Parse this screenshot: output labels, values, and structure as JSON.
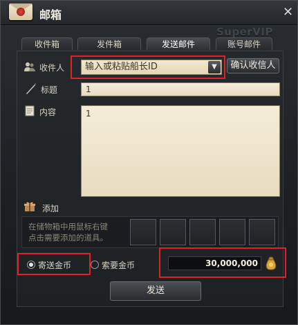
{
  "window": {
    "title": "邮箱",
    "watermark": "SuperVIP"
  },
  "tabs": [
    {
      "label": "收件箱"
    },
    {
      "label": "发件箱"
    },
    {
      "label": "发送邮件"
    },
    {
      "label": "账号邮件"
    }
  ],
  "form": {
    "recipient_label": "收件人",
    "recipient_placeholder": "输入或粘贴船长ID",
    "confirm_button": "确认收信人",
    "subject_label": "标题",
    "subject_value": "1",
    "content_label": "内容",
    "content_value": "1"
  },
  "attachment": {
    "label": "添加",
    "hint_line1": "在储物箱中用鼠标右键",
    "hint_line2": "点击需要添加的道具。",
    "slot_count": 5
  },
  "gold": {
    "send_label": "寄送金币",
    "request_label": "索要金币",
    "selected": "send",
    "amount": "30,000,000"
  },
  "actions": {
    "send_button": "发送"
  },
  "colors": {
    "highlight": "#e0202a",
    "accent": "#f2eee4"
  }
}
